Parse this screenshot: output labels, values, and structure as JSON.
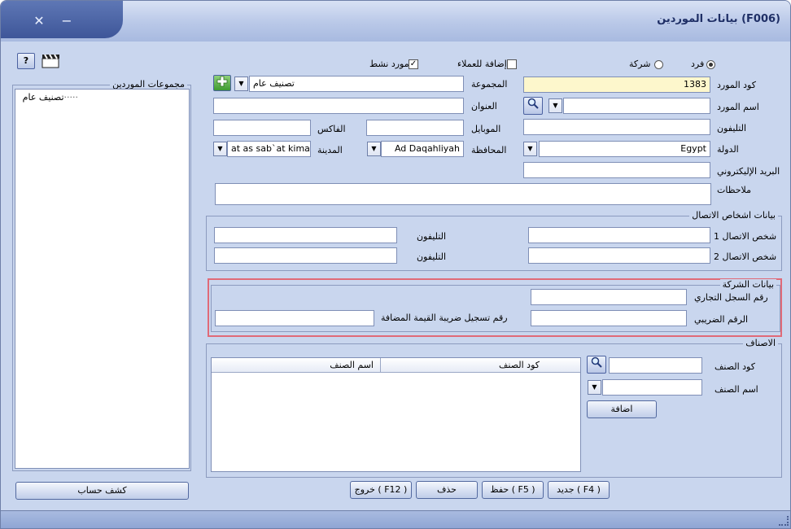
{
  "window": {
    "title": "بيانات الموردين  (F006)"
  },
  "toolbar_icons": [
    "help-icon",
    "clapperboard-icon"
  ],
  "supplier_type": {
    "individual_label": "فرد",
    "company_label": "شركة",
    "selected": "individual"
  },
  "flags": {
    "add_to_customers_label": "إضافة للعملاء",
    "add_to_customers_checked": false,
    "active_supplier_label": "مورد نشط",
    "active_supplier_checked": true
  },
  "fields": {
    "supplier_code_label": "كود المورد",
    "supplier_code": "1383",
    "supplier_name_label": "اسم المورد",
    "supplier_name": "",
    "phone_label": "التليفون",
    "phone": "",
    "country_label": "الدولة",
    "country": "Egypt",
    "email_label": "البريد الإليكتروني",
    "email": "",
    "notes_label": "ملاحظات",
    "notes": "",
    "group_label": "المجموعة",
    "group": "تصنيف عام",
    "address_label": "العنوان",
    "address": "",
    "mobile_label": "الموبايل",
    "mobile": "",
    "fax_label": "الفاكس",
    "fax": "",
    "governorate_label": "المحافظة",
    "governorate": "Ad Daqahliyah",
    "city_label": "المدينة",
    "city": "at as sab`at kiman`"
  },
  "contacts": {
    "title": "بيانات اشخاص الاتصال",
    "contact1_label": "شخص الاتصال 1",
    "contact1": "",
    "contact2_label": "شخص الاتصال 2",
    "contact2": "",
    "phone1_label": "التليفون",
    "phone1": "",
    "phone2_label": "التليفون",
    "phone2": ""
  },
  "company": {
    "title": "بيانات الشركة",
    "commercial_register_label": "رقم السجل التجاري",
    "commercial_register": "",
    "tax_number_label": "الرقم الضريبي",
    "tax_number": "",
    "vat_label": "رقم تسجيل ضريبة القيمة المضافة",
    "vat": ""
  },
  "items": {
    "title": "الاصناف",
    "item_code_label": "كود الصنف",
    "item_code": "",
    "item_name_label": "اسم الصنف",
    "item_name": "",
    "add_button": "اضافة",
    "columns": [
      "كود الصنف",
      "اسم الصنف"
    ],
    "rows": []
  },
  "groups_panel": {
    "title": "مجموعات الموردين",
    "tree": [
      "تصنيف عام"
    ]
  },
  "buttons": {
    "account_statement": "كشف حساب",
    "new": "جديد ( F4 )",
    "save": "حفظ ( F5 )",
    "delete": "حذف",
    "exit": "خروج ( F12 )"
  },
  "colors": {
    "window_bg": "#c9d6ee",
    "highlight_border": "#e06a78",
    "code_field_bg": "#fdf7cc"
  }
}
